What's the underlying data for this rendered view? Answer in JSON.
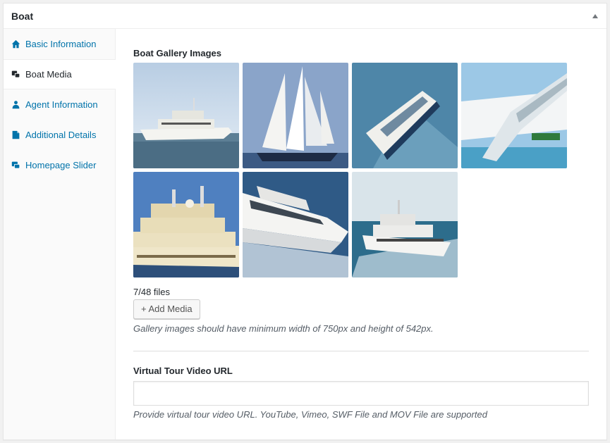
{
  "metabox": {
    "title": "Boat"
  },
  "tabs": [
    {
      "label": "Basic Information",
      "icon": "home-icon"
    },
    {
      "label": "Boat Media",
      "icon": "media-icon"
    },
    {
      "label": "Agent Information",
      "icon": "user-icon"
    },
    {
      "label": "Additional Details",
      "icon": "document-icon"
    },
    {
      "label": "Homepage Slider",
      "icon": "slider-icon"
    }
  ],
  "gallery": {
    "label": "Boat Gallery Images",
    "file_count": "7/48 files",
    "add_button": "+ Add Media",
    "description": "Gallery images should have minimum width of 750px and height of 542px."
  },
  "video": {
    "label": "Virtual Tour Video URL",
    "value": "",
    "placeholder": "",
    "description": "Provide virtual tour video URL. YouTube, Vimeo, SWF File and MOV File are supported"
  },
  "colors": {
    "link": "#0073aa",
    "text": "#23282d"
  }
}
